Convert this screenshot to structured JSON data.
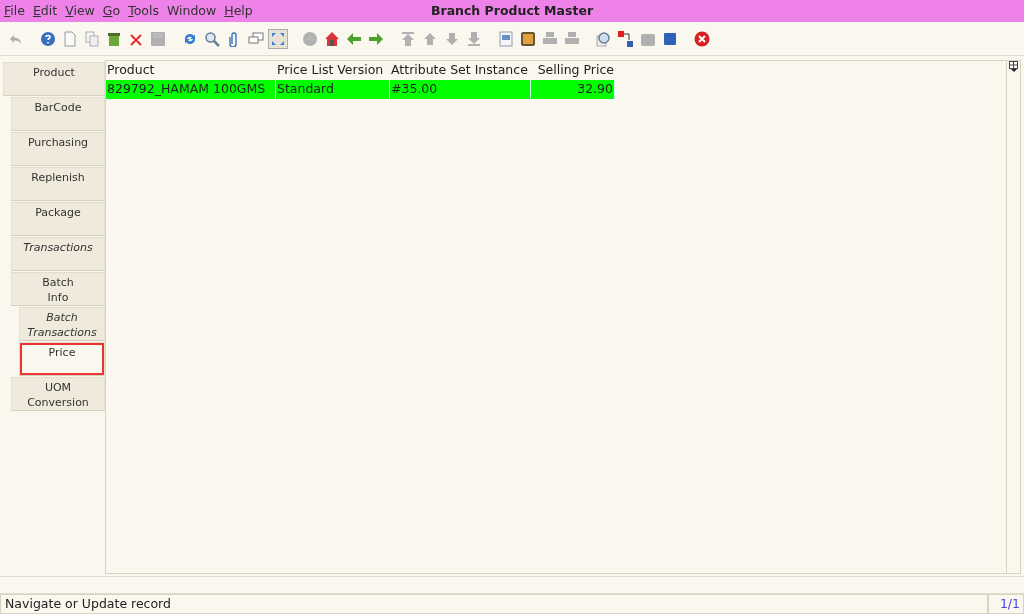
{
  "menu": [
    {
      "mnemonic": "F",
      "rest": "ile"
    },
    {
      "mnemonic": "E",
      "rest": "dit"
    },
    {
      "mnemonic": "V",
      "rest": "iew"
    },
    {
      "mnemonic": "G",
      "rest": "o"
    },
    {
      "mnemonic": "T",
      "rest": "ools"
    },
    {
      "rest": "Window"
    },
    {
      "mnemonic": "H",
      "rest": "elp"
    }
  ],
  "window": {
    "title": "Branch Product Master"
  },
  "toolbar": [
    {
      "kind": "undo",
      "disabled": true,
      "pressed": false
    },
    {
      "kind": "gap"
    },
    {
      "kind": "help",
      "disabled": false,
      "pressed": false
    },
    {
      "kind": "new",
      "disabled": false,
      "pressed": false
    },
    {
      "kind": "copy",
      "disabled": true,
      "pressed": false
    },
    {
      "kind": "bin",
      "disabled": false,
      "pressed": false
    },
    {
      "kind": "delete",
      "disabled": false,
      "pressed": false
    },
    {
      "kind": "save",
      "disabled": true,
      "pressed": false
    },
    {
      "kind": "gap"
    },
    {
      "kind": "refresh",
      "disabled": false,
      "pressed": false
    },
    {
      "kind": "search",
      "disabled": false,
      "pressed": false
    },
    {
      "kind": "attach",
      "disabled": false,
      "pressed": false
    },
    {
      "kind": "chat",
      "disabled": false,
      "pressed": false
    },
    {
      "kind": "expand",
      "disabled": false,
      "pressed": true
    },
    {
      "kind": "gap"
    },
    {
      "kind": "history",
      "disabled": true,
      "pressed": false
    },
    {
      "kind": "home",
      "disabled": false,
      "pressed": false
    },
    {
      "kind": "back",
      "disabled": false,
      "pressed": false
    },
    {
      "kind": "forward",
      "disabled": false,
      "pressed": false
    },
    {
      "kind": "gap"
    },
    {
      "kind": "first",
      "disabled": true,
      "pressed": false
    },
    {
      "kind": "up",
      "disabled": true,
      "pressed": false
    },
    {
      "kind": "down",
      "disabled": true,
      "pressed": false
    },
    {
      "kind": "last",
      "disabled": true,
      "pressed": false
    },
    {
      "kind": "gap"
    },
    {
      "kind": "report",
      "disabled": false,
      "pressed": false
    },
    {
      "kind": "archive",
      "disabled": false,
      "pressed": false
    },
    {
      "kind": "print",
      "disabled": true,
      "pressed": false
    },
    {
      "kind": "print",
      "disabled": true,
      "pressed": false
    },
    {
      "kind": "gap"
    },
    {
      "kind": "zoom",
      "disabled": false,
      "pressed": false
    },
    {
      "kind": "workflow",
      "disabled": false,
      "pressed": false
    },
    {
      "kind": "info",
      "disabled": true,
      "pressed": false
    },
    {
      "kind": "toggle",
      "disabled": false,
      "pressed": false
    },
    {
      "kind": "gap"
    },
    {
      "kind": "close",
      "disabled": false,
      "pressed": false
    }
  ],
  "tabs": [
    {
      "label": "Product",
      "italic": false,
      "selected": false,
      "children": [
        {
          "label": "BarCode",
          "italic": false,
          "selected": false
        },
        {
          "label": "Purchasing",
          "italic": false,
          "selected": false
        },
        {
          "label": "Replenish",
          "italic": false,
          "selected": false
        },
        {
          "label": "Package",
          "italic": false,
          "selected": false
        },
        {
          "label": "Transactions",
          "italic": true,
          "selected": false
        },
        {
          "label": "Batch\nInfo",
          "italic": false,
          "selected": false,
          "children": [
            {
              "label": "Batch\nTransactions",
              "italic": true,
              "selected": false
            },
            {
              "label": "Price",
              "italic": false,
              "selected": true
            }
          ]
        },
        {
          "label": "UOM\nConversion",
          "italic": false,
          "selected": false
        }
      ]
    }
  ],
  "table": {
    "columns": [
      {
        "label": "Product",
        "numeric": false
      },
      {
        "label": "Price List Version",
        "numeric": false
      },
      {
        "label": "Attribute Set Instance",
        "numeric": false
      },
      {
        "label": "Selling Price",
        "numeric": true
      }
    ],
    "rows": [
      {
        "selected": true,
        "cells": [
          "829792_HAMAM 100GMS",
          "Standard",
          "#35.00",
          "32.90"
        ]
      }
    ]
  },
  "status_bar": {
    "message": "Navigate or Update record",
    "record": "1/1"
  }
}
